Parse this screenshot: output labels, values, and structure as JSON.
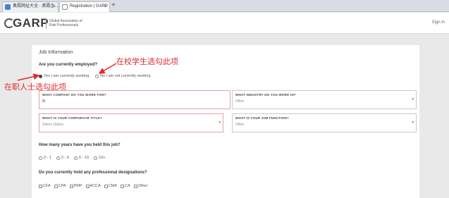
{
  "browser": {
    "tabs": [
      {
        "label": "奥霞网址大全 - 奥霞企...",
        "close": "×"
      },
      {
        "label": "Registration | GARP",
        "close": "×"
      }
    ],
    "new_tab": "+"
  },
  "header": {
    "logo_text": "GARP",
    "logo_sub": "Global Association of Risk Professionals",
    "signin": "Sign in"
  },
  "form": {
    "section_title": "Job Information",
    "employed_question": "Are you currently employed?",
    "employed_yes": "Yes I am currently working",
    "employed_no": "No I am not currently working",
    "fields": {
      "company_label": "WHAT COMPANY DO YOU WORK FOR?",
      "company_value": "Bi",
      "industry_label": "WHAT INDUSTRY DO YOU WORK IN?",
      "industry_value": "Other",
      "title_label": "WHAT IS YOUR CORPORATE TITLE?",
      "title_value": "Select Option",
      "function_label": "WHAT IS YOUR JOB FUNCTION?",
      "function_value": "Other"
    },
    "years_question": "How many years have you held this job?",
    "years_options": [
      "0 - 1",
      "2 - 5",
      "6 - 10",
      "10+"
    ],
    "designations_question": "Do you currently hold any professional designations?",
    "designations": [
      "CFA",
      "CPA",
      "PMP",
      "ACCA",
      "CMA",
      "CA",
      "Other"
    ]
  },
  "annotations": {
    "student": "在校学生选勾此项",
    "professional": "在职人士选勾此项"
  },
  "colors": {
    "annotation": "#e0292b"
  }
}
